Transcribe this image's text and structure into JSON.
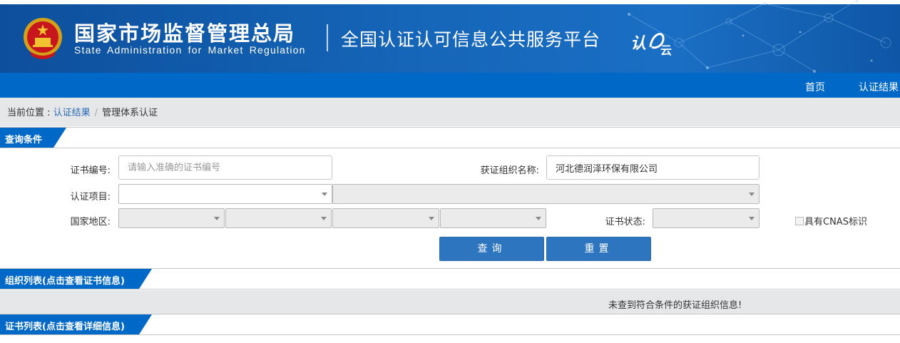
{
  "header": {
    "brand_cn": "国家市场监督管理总局",
    "brand_en": "State Administration  for  Market Regulation",
    "platform_title": "全国认证认可信息公共服务平台",
    "colors": {
      "banner": "#1565b8",
      "nav": "#0068c6",
      "button": "#2e75c0"
    }
  },
  "nav": {
    "items": [
      {
        "label": "首页"
      },
      {
        "label": "认证结果"
      }
    ]
  },
  "breadcrumb": {
    "prefix": "当前位置 : ",
    "link": "认证结果",
    "separator": "/",
    "current": "管理体系认证"
  },
  "query": {
    "section_title": "查询条件",
    "cert_no_label": "证书编号:",
    "cert_no_placeholder": "请输入准确的证书编号",
    "cert_no_value": "",
    "org_name_label": "获证组织名称:",
    "org_name_value": "河北德润泽环保有限公司",
    "project_label": "认证项目:",
    "region_label": "国家地区:",
    "status_label": "证书状态:",
    "cnas_label": "具有CNAS标识",
    "search_button": "查询",
    "reset_button": "重置"
  },
  "org_list": {
    "section_title": "组织列表(点击查看证书信息)",
    "empty_message": "未查到符合条件的获证组织信息!"
  },
  "cert_list": {
    "section_title": "证书列表(点击查看详细信息)"
  },
  "icons": [
    "national-emblem-icon",
    "cloud-logo-icon",
    "chevron-down-icon",
    "checkbox-icon"
  ]
}
